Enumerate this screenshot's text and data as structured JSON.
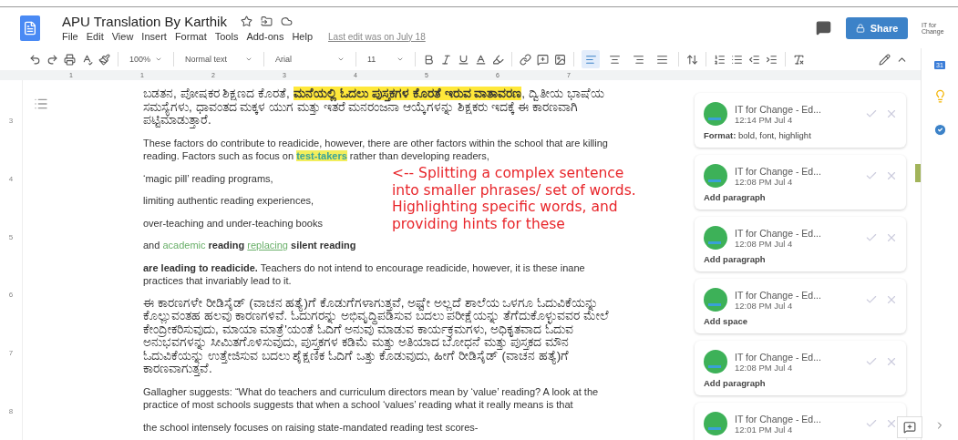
{
  "document": {
    "title": "APU Translation By Karthik",
    "menu": [
      "File",
      "Edit",
      "View",
      "Insert",
      "Format",
      "Tools",
      "Add-ons",
      "Help"
    ],
    "last_edit": "Last edit was on July 18"
  },
  "share_button": "Share",
  "account_logo": "IT for Change",
  "toolbar": {
    "zoom": "100%",
    "style": "Normal text",
    "font": "Arial",
    "size": "11",
    "align": [
      {
        "kind": "left",
        "selected": true
      },
      {
        "kind": "center",
        "selected": false
      },
      {
        "kind": "right",
        "selected": false
      },
      {
        "kind": "justify",
        "selected": false
      }
    ]
  },
  "ruler": [
    "1",
    "1",
    "2",
    "3",
    "4",
    "5",
    "6",
    "7"
  ],
  "side_ruler": [
    "3",
    "4",
    "5",
    "6",
    "7",
    "8"
  ],
  "paragraphs": [
    {
      "kind": "kannada",
      "runs": [
        {
          "text": "ಬಡತನ, ಪೋಷಕರ ಶಿಕ್ಷಣದ ಕೊರತೆ, ",
          "kind": "plain"
        },
        {
          "text": "ಮನೆಯಲ್ಲಿ  ಓದಲು ಪುಸ್ತಕಗಳ ಕೊರತೆ ಇರುವ ವಾತಾವರಣ",
          "kind": "marked"
        },
        {
          "text": ", ದ್ವಿತೀಯ ಭಾಷೆಯ ಸಮಸ್ಯೆಗಳು, ಧಾವಂತದ ಮಕ್ಕಳ ಯುಗ ಮತ್ತು ಇತರೆ ಮನರಂಜನಾ ಆಯ್ಕೆಗಳನ್ನು ಶಿಕ್ಷಕರು ಇದಕ್ಕೆ ಈ ಕಾರಣವಾಗಿ ಪಟ್ಟಿಮಾಡುತ್ತಾರೆ.",
          "kind": "plain"
        }
      ]
    },
    {
      "kind": "english",
      "runs": [
        {
          "text": "These factors do contribute to readicide, however, there are other factors within the school that are killing reading. Factors such as focus on ",
          "kind": "plain"
        },
        {
          "text": "test-takers",
          "kind": "highlight"
        },
        {
          "text": " rather than developing readers,",
          "kind": "plain"
        }
      ]
    },
    {
      "kind": "english",
      "runs": [
        {
          "text": "‘magic pill’ reading programs,",
          "kind": "plain"
        }
      ]
    },
    {
      "kind": "english",
      "runs": [
        {
          "text": "limiting authentic  reading experiences,",
          "kind": "plain"
        }
      ]
    },
    {
      "kind": "english",
      "runs": [
        {
          "text": "over-teaching and under-teaching books",
          "kind": "plain"
        }
      ]
    },
    {
      "kind": "english",
      "runs": [
        {
          "text": "and ",
          "kind": "plain"
        },
        {
          "text": "academic",
          "kind": "accent"
        },
        {
          "text": " reading ",
          "kind": "bold"
        },
        {
          "text": "replacing",
          "kind": "link"
        },
        {
          "text": " silent reading",
          "kind": "bold"
        }
      ]
    },
    {
      "kind": "english",
      "runs": [
        {
          "text": "are leading to readicide.",
          "kind": "bold"
        },
        {
          "text": " Teachers do not intend to encourage readicide, however, it is these inane practices that invariably lead to it.",
          "kind": "plain"
        }
      ]
    },
    {
      "kind": "kannada",
      "runs": [
        {
          "text": "ಈ ಕಾರಣಗಳೇ ರೀಡಿಸೈಡ್ (ವಾಚನ ಹತ್ಯೆ)ಗೆ ಕೊಡುಗೆಗಳಾಗುತ್ತವೆ, ಅಷ್ಟೇ ಅಲ್ಲದೆ ಶಾಲೆಯ ಒಳಗೂ ಓದುವಿಕೆಯನ್ನು ಕೊಲ್ಲುವಂತಹ ಹಲವು ಕಾರಣಗಳಿವೆ. ಓದುಗರನ್ನು ಅಭಿವೃದ್ಧಿಪಡಿಸುವ ಬದಲು ಪರೀಕ್ಷೆಯನ್ನು ತೆಗೆದುಕೊಳ್ಳುವವರ ಮೇಲೆ ಕೇಂದ್ರೀಕರಿಸುವುದು,  ಮಾಯಾ ಮಾತ್ರೆ'ಯಂತೆ ಓದಿಗೆ ಅನುವು ಮಾಡುವ ಕಾರ್ಯಕ್ರಮಗಳು, ಅಧಿಕೃತವಾದ ಓದುವ ಅನುಭವಗಳನ್ನು ಸೀಮಿತಗೊಳಿಸುವುದು,  ಪುಸ್ತಕಗಳ ಕಡಿಮೆ ಮತ್ತು ಅತಿಯಾದ ಬೋಧನೆ ಮತ್ತು ಪುಸ್ತಕದ ಮೌನ ಓದುವಿಕೆಯನ್ನು ಉತ್ತೇಜಿಸುವ ಬದಲು ಶೈಕ್ಷಣಿಕ ಓದಿಗೆ ಒತ್ತು ಕೊಡುವುದು, ಹೀಗೆ ರೀಡಿಸೈಡ್ (ವಾಚನ ಹತ್ಯೆ)ಗೆ ಕಾರಣವಾಗುತ್ತವೆ.",
          "kind": "plain"
        }
      ]
    },
    {
      "kind": "english",
      "runs": [
        {
          "text": "Gallagher suggests: “What do teachers and curriculum directors mean by ‘value’ reading? A look at the practice of most schools suggests that when a school ‘values’ reading what it really means is that",
          "kind": "plain"
        }
      ]
    },
    {
      "kind": "english",
      "runs": [
        {
          "text": "the school intensely focuses on raising state-mandated reading test scores-",
          "kind": "plain"
        }
      ]
    }
  ],
  "annotation": "<--  Splitting a complex sentence into smaller phrases/ set of words. Highlighting specific words, and providing hints for these",
  "comments": [
    {
      "author": "IT for Change - Ed...",
      "time": "12:14 PM Jul 4",
      "kind": "format",
      "body": "**Format:** bold, font, highlight"
    },
    {
      "author": "IT for Change - Ed...",
      "time": "12:08 PM Jul 4",
      "kind": "change",
      "body": "Add paragraph"
    },
    {
      "author": "IT for Change - Ed...",
      "time": "12:08 PM Jul 4",
      "kind": "change",
      "body": "Add paragraph"
    },
    {
      "author": "IT for Change - Ed...",
      "time": "12:08 PM Jul 4",
      "kind": "change",
      "body": "Add space"
    },
    {
      "author": "IT for Change - Ed...",
      "time": "12:08 PM Jul 4",
      "kind": "change",
      "body": "Add paragraph"
    },
    {
      "author": "IT for Change - Ed...",
      "time": "12:01 PM Jul 4"
    }
  ],
  "calendar_day": "31"
}
